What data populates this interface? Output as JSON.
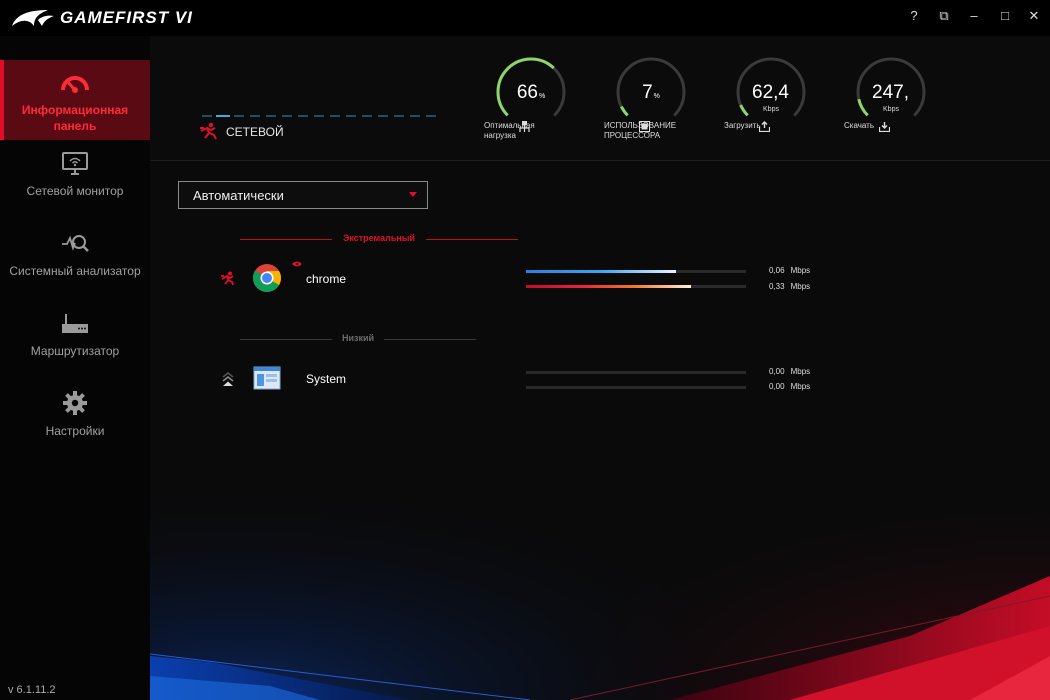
{
  "app": {
    "title": "GAMEFIRST VI",
    "version": "v 6.1.11.2"
  },
  "window_controls": {
    "help": "?",
    "restore_alt": "⧉",
    "minimize": "–",
    "maximize": "□",
    "close": "✕"
  },
  "sidebar": {
    "items": [
      {
        "label": "Информационная панель",
        "icon": "dashboard-gauge-icon",
        "active": true
      },
      {
        "label": "Сетевой монитор",
        "icon": "network-monitor-icon",
        "active": false
      },
      {
        "label": "Системный анализатор",
        "icon": "system-analyzer-icon",
        "active": false
      },
      {
        "label": "Маршрутизатор",
        "icon": "router-icon",
        "active": false
      },
      {
        "label": "Настройки",
        "icon": "settings-gear-icon",
        "active": false
      }
    ]
  },
  "network": {
    "label": "СЕТЕВОЙ"
  },
  "gauges": [
    {
      "value": "66",
      "unit": "%",
      "sub": "",
      "caption": "Оптимальная нагрузка",
      "icon": "optimal-load-icon",
      "fraction": 0.66,
      "color": "#8fd46b"
    },
    {
      "value": "7",
      "unit": "%",
      "sub": "",
      "caption": "ИСПОЛЬЗОВАНИЕ ПРОЦЕССОРА",
      "icon": "cpu-icon",
      "fraction": 0.07,
      "color": "#8fd46b"
    },
    {
      "value": "62,4",
      "unit": "",
      "sub": "Kbps",
      "caption": "Загрузить",
      "icon": "upload-icon",
      "fraction": 0.08,
      "color": "#8fd46b"
    },
    {
      "value": "247,",
      "unit": "",
      "sub": "Kbps",
      "caption": "Скачать",
      "icon": "download-icon",
      "fraction": 0.12,
      "color": "#8fd46b"
    }
  ],
  "mode_select": {
    "value": "Автоматически"
  },
  "groups": [
    {
      "name": "Экстремальный",
      "color": "#e0102a",
      "apps": [
        {
          "name": "chrome",
          "icon": "chrome-icon",
          "upload": "0,06",
          "download": "0,33",
          "unit": "Mbps",
          "upload_fraction": 0.68,
          "download_fraction": 0.75
        }
      ]
    },
    {
      "name": "Низкий",
      "color": "#6d6d6d",
      "apps": [
        {
          "name": "System",
          "icon": "system-window-icon",
          "upload": "0,00",
          "download": "0,00",
          "unit": "Mbps",
          "upload_fraction": 0,
          "download_fraction": 0
        }
      ]
    }
  ],
  "colors": {
    "accent": "#e00c2a",
    "upload_bar": "#2a8fe0",
    "download_bar": "#e01030"
  }
}
